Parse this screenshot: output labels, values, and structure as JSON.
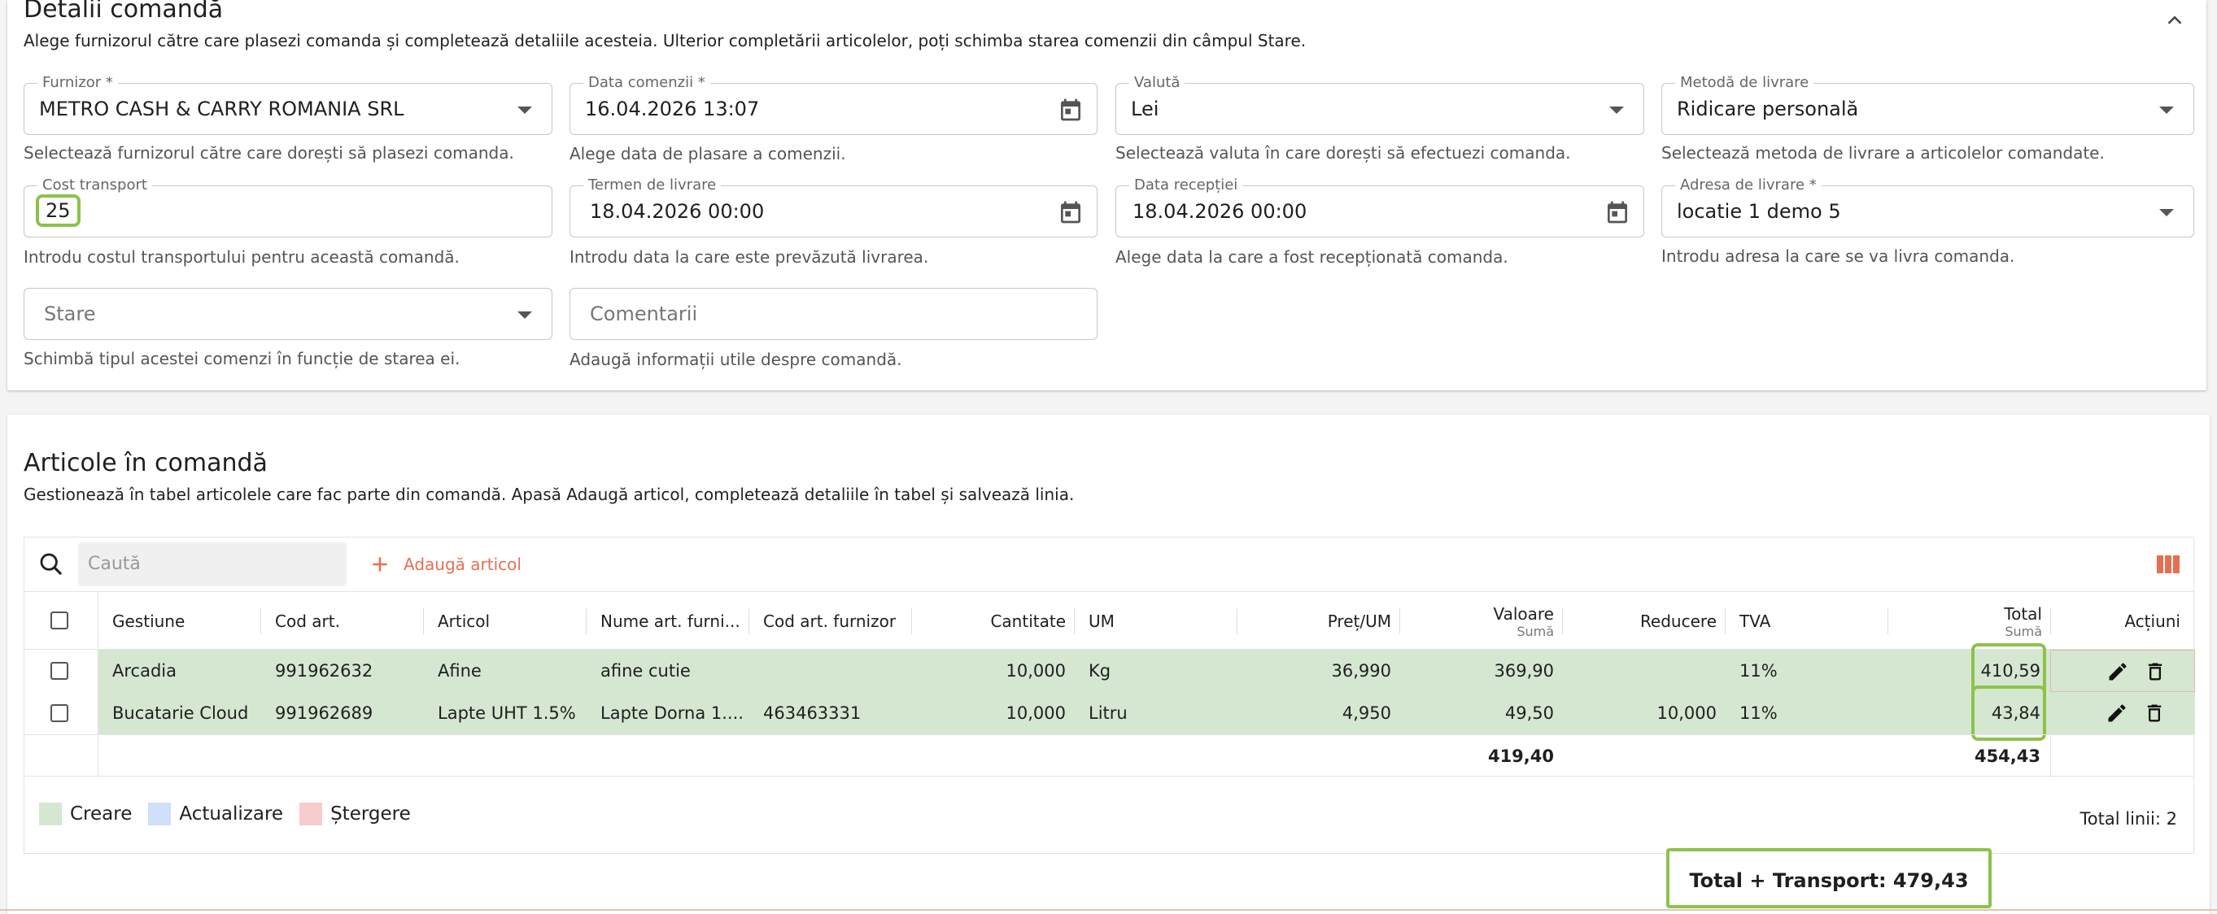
{
  "details": {
    "title": "Detalii comandă",
    "subtitle": "Alege furnizorul către care plasezi comanda și completează detaliile acesteia. Ulterior completării articolelor, poți schimba starea comenzii din câmpul Stare.",
    "fields": {
      "furnizor": {
        "label": "Furnizor *",
        "value": "METRO CASH & CARRY ROMANIA SRL",
        "hint": "Selectează furnizorul către care dorești să plasezi comanda."
      },
      "data_comenzii": {
        "label": "Data comenzii *",
        "value": "16.04.2026 13:07",
        "hint": "Alege data de plasare a comenzii."
      },
      "valuta": {
        "label": "Valută",
        "value": "Lei",
        "hint": "Selectează valuta în care dorești să efectuezi comanda."
      },
      "metoda_livrare": {
        "label": "Metodă de livrare",
        "value": "Ridicare personală",
        "hint": "Selectează metoda de livrare a articolelor comandate."
      },
      "cost_transport": {
        "label": "Cost transport",
        "value": "25",
        "hint": "Introdu costul transportului pentru această comandă."
      },
      "termen_livrare": {
        "label": "Termen de livrare",
        "value": "18.04.2026 00:00",
        "hint": "Introdu data la care este prevăzută livrarea."
      },
      "data_receptiei": {
        "label": "Data recepției",
        "value": "18.04.2026 00:00",
        "hint": "Alege data la care a fost recepționată comanda."
      },
      "adresa_livrare": {
        "label": "Adresa de livrare *",
        "value": "locatie 1 demo 5",
        "hint": "Introdu adresa la care se va livra comanda."
      },
      "stare": {
        "placeholder": "Stare",
        "hint": "Schimbă tipul acestei comenzi în funcție de starea ei."
      },
      "comentarii": {
        "placeholder": "Comentarii",
        "hint": "Adaugă informații utile despre comandă."
      }
    }
  },
  "articles": {
    "title": "Articole în comandă",
    "subtitle": "Gestionează în tabel articolele care fac parte din comandă. Apasă Adaugă articol, completează detaliile în tabel și salvează linia.",
    "search_placeholder": "Caută",
    "add_label": "Adaugă articol",
    "columns": {
      "gestiune": "Gestiune",
      "cod_art": "Cod art.",
      "articol": "Articol",
      "nume_furnizor": "Nume art. furni...",
      "cod_furnizor": "Cod art. furnizor",
      "cantitate": "Cantitate",
      "um": "UM",
      "pret": "Preț/UM",
      "valoare": "Valoare",
      "valoare_sub": "Sumă",
      "reducere": "Reducere",
      "tva": "TVA",
      "total": "Total",
      "total_sub": "Sumă",
      "actiuni": "Acțiuni"
    },
    "rows": [
      {
        "gestiune": "Arcadia",
        "cod_art": "991962632",
        "articol": "Afine",
        "nume_furnizor": "afine cutie",
        "cod_furnizor": "",
        "cantitate": "10,000",
        "um": "Kg",
        "pret": "36,990",
        "valoare": "369,90",
        "reducere": "",
        "tva": "11%",
        "total": "410,59"
      },
      {
        "gestiune": "Bucatarie Cloud",
        "cod_art": "991962689",
        "articol": "Lapte UHT 1.5%",
        "nume_furnizor": "Lapte Dorna 1....",
        "cod_furnizor": "463463331",
        "cantitate": "10,000",
        "um": "Litru",
        "pret": "4,950",
        "valoare": "49,50",
        "reducere": "10,000",
        "tva": "11%",
        "total": "43,84"
      }
    ],
    "footer": {
      "valoare_sum": "419,40",
      "total_sum": "454,43"
    },
    "legend": {
      "create": "Creare",
      "update": "Actualizare",
      "delete": "Ștergere"
    },
    "legend_colors": {
      "create": "#d6e7d1",
      "update": "#cfe0fb",
      "delete": "#f8cccc"
    },
    "total_lines": "Total linii: 2",
    "grand_total": "Total + Transport: 479,43"
  },
  "colors": {
    "accent": "#e76f51",
    "highlight": "#8bc34a",
    "created_row": "#d6e7d1"
  }
}
